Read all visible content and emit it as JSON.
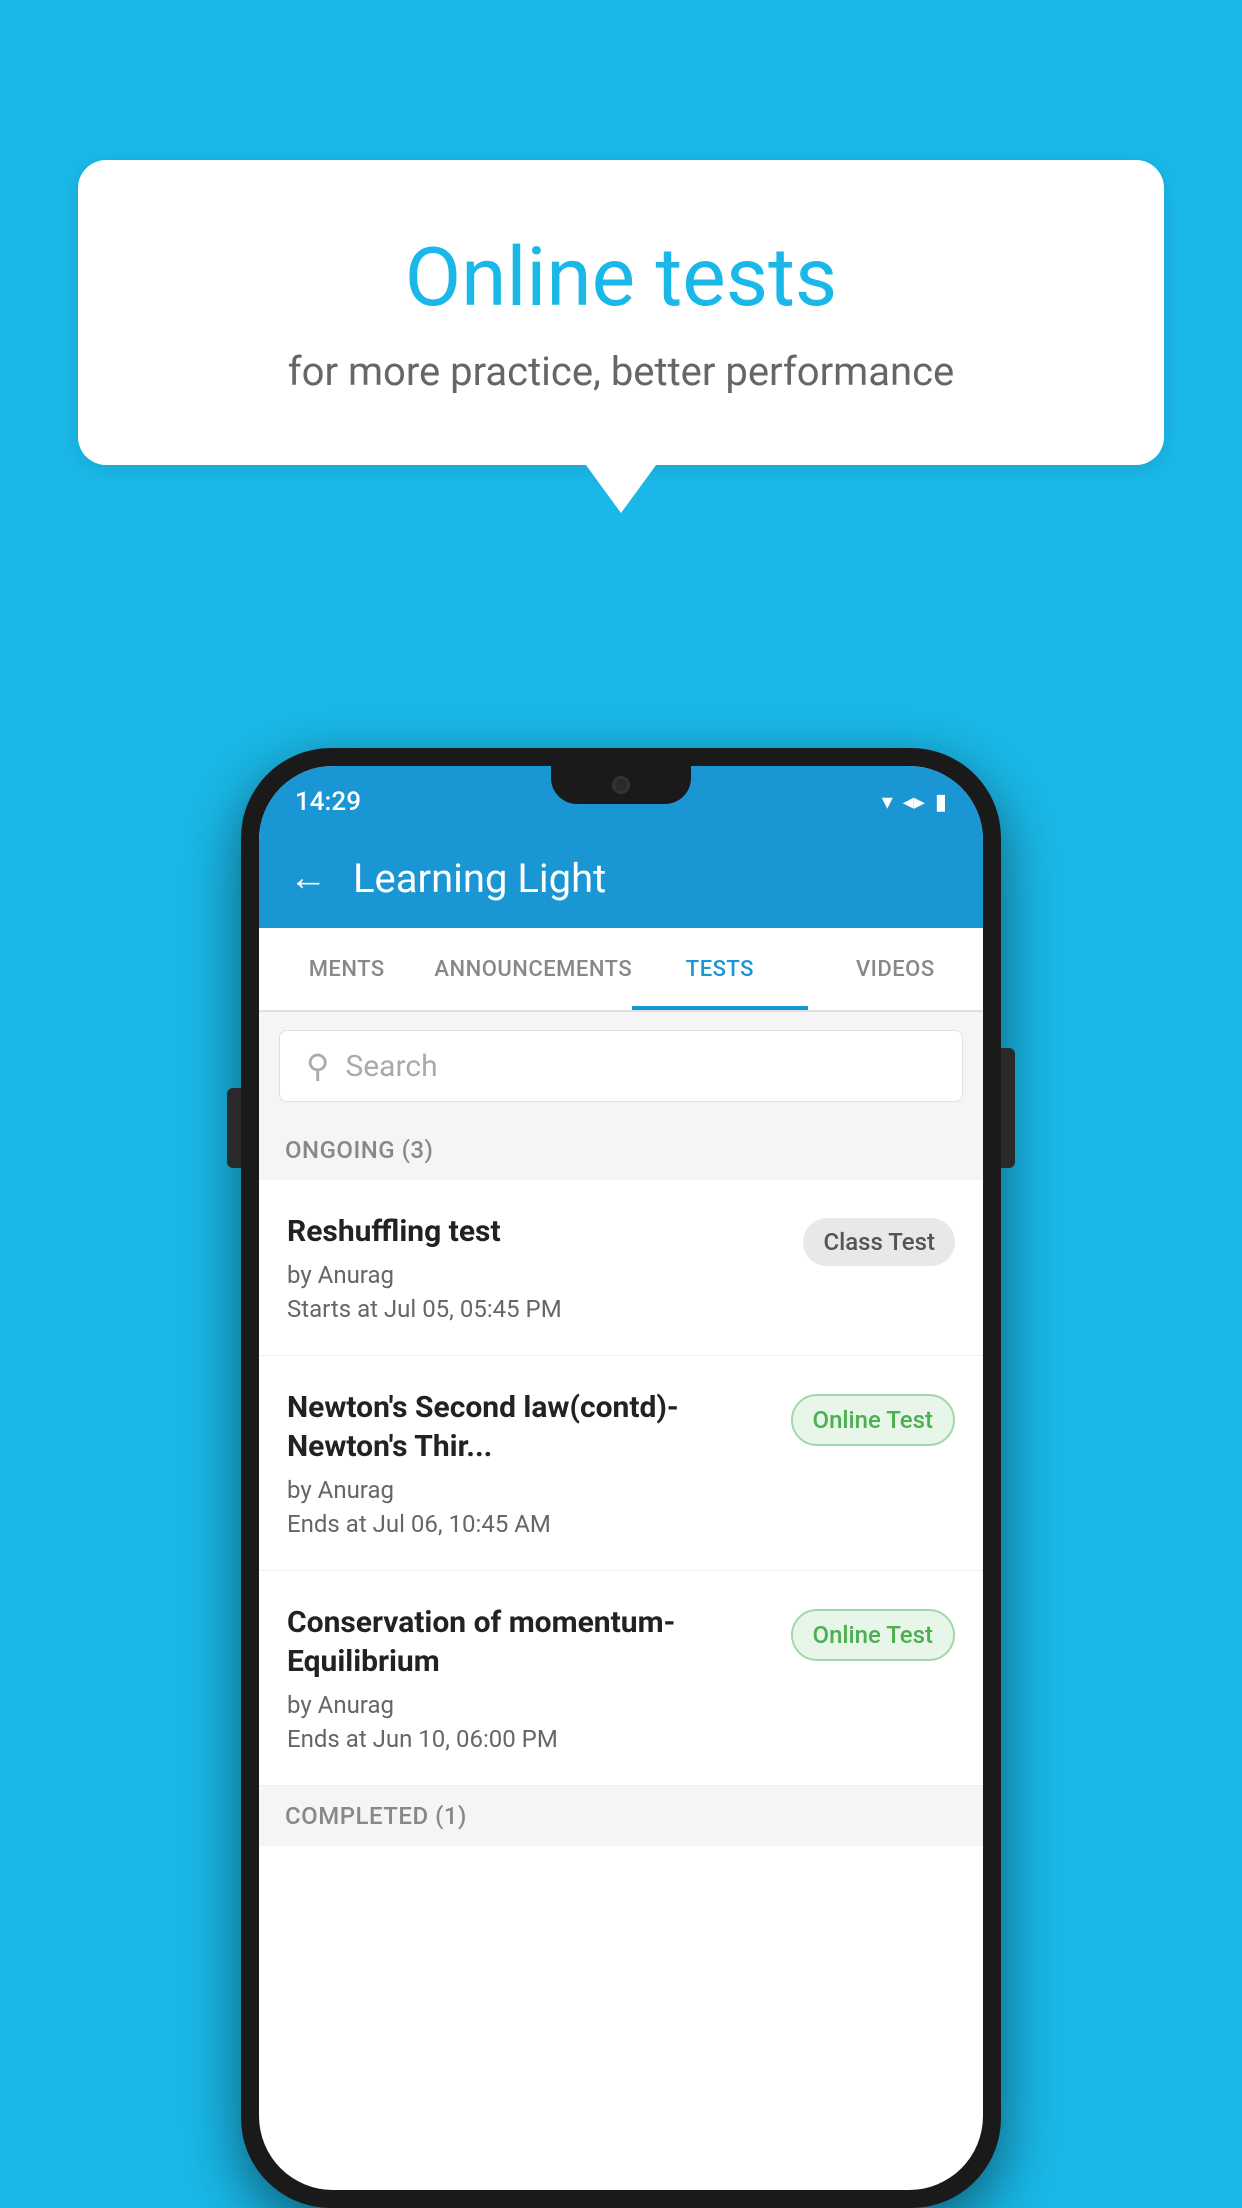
{
  "background": {
    "color": "#1ab8e8"
  },
  "speech_bubble": {
    "title": "Online tests",
    "subtitle": "for more practice, better performance"
  },
  "phone": {
    "status_bar": {
      "time": "14:29",
      "icons": [
        "wifi",
        "signal",
        "battery"
      ]
    },
    "app_header": {
      "title": "Learning Light",
      "back_label": "←"
    },
    "tabs": [
      {
        "label": "MENTS",
        "active": false
      },
      {
        "label": "ANNOUNCEMENTS",
        "active": false
      },
      {
        "label": "TESTS",
        "active": true
      },
      {
        "label": "VIDEOS",
        "active": false
      }
    ],
    "search": {
      "placeholder": "Search"
    },
    "sections": [
      {
        "title": "ONGOING (3)",
        "items": [
          {
            "name": "Reshuffling test",
            "by": "by Anurag",
            "date": "Starts at  Jul 05, 05:45 PM",
            "badge": "Class Test",
            "badge_type": "class"
          },
          {
            "name": "Newton's Second law(contd)-Newton's Thir...",
            "by": "by Anurag",
            "date": "Ends at  Jul 06, 10:45 AM",
            "badge": "Online Test",
            "badge_type": "online"
          },
          {
            "name": "Conservation of momentum-Equilibrium",
            "by": "by Anurag",
            "date": "Ends at  Jun 10, 06:00 PM",
            "badge": "Online Test",
            "badge_type": "online"
          }
        ]
      }
    ],
    "completed_section": {
      "title": "COMPLETED (1)"
    }
  }
}
